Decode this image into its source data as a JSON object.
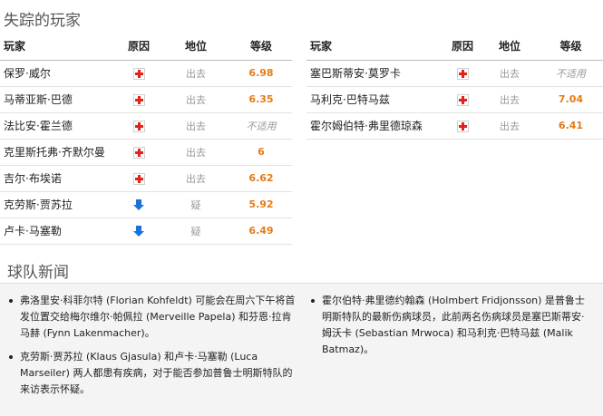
{
  "missing_players": {
    "title": "失踪的玩家",
    "headers": {
      "player": "玩家",
      "reason": "原因",
      "status": "地位",
      "rating": "等级"
    },
    "left_rows": [
      {
        "player": "保罗·威尔",
        "reason_icon": "injury-icon",
        "status": "出去",
        "rating": "6.98",
        "rating_na": false
      },
      {
        "player": "马蒂亚斯·巴德",
        "reason_icon": "injury-icon",
        "status": "出去",
        "rating": "6.35",
        "rating_na": false
      },
      {
        "player": "法比安·霍兰德",
        "reason_icon": "injury-icon",
        "status": "出去",
        "rating": "不适用",
        "rating_na": true
      },
      {
        "player": "克里斯托弗·齐默尔曼",
        "reason_icon": "injury-icon",
        "status": "出去",
        "rating": "6",
        "rating_na": false
      },
      {
        "player": "吉尔·布埃诺",
        "reason_icon": "injury-icon",
        "status": "出去",
        "rating": "6.62",
        "rating_na": false
      },
      {
        "player": "克劳斯·贾苏拉",
        "reason_icon": "doubt-arrow-icon",
        "status": "疑",
        "rating": "5.92",
        "rating_na": false
      },
      {
        "player": "卢卡·马塞勒",
        "reason_icon": "doubt-arrow-icon",
        "status": "疑",
        "rating": "6.49",
        "rating_na": false
      }
    ],
    "right_rows": [
      {
        "player": "塞巴斯蒂安·莫罗卡",
        "reason_icon": "injury-icon",
        "status": "出去",
        "rating": "不适用",
        "rating_na": true
      },
      {
        "player": "马利克·巴特马兹",
        "reason_icon": "injury-icon",
        "status": "出去",
        "rating": "7.04",
        "rating_na": false
      },
      {
        "player": "霍尔姆伯特·弗里德琼森",
        "reason_icon": "injury-icon",
        "status": "出去",
        "rating": "6.41",
        "rating_na": false
      }
    ]
  },
  "team_news": {
    "title": "球队新闻",
    "left_items": [
      "弗洛里安·科菲尔特 (Florian Kohfeldt) 可能会在周六下午将首发位置交给梅尔维尔·帕佩拉 (Merveille Papela) 和芬恩·拉肯马赫 (Fynn Lakenmacher)。",
      "克劳斯·贾苏拉 (Klaus Gjasula) 和卢卡·马塞勒 (Luca Marseiler) 两人都患有疾病，对于能否参加普鲁士明斯特队的来访表示怀疑。"
    ],
    "right_items": [
      "霍尔伯特·弗里德约翰森 (Holmbert Fridjonsson) 是普鲁士明斯特队的最新伤病球员，此前两名伤病球员是塞巴斯蒂安·姆沃卡 (Sebastian Mrwoca) 和马利克·巴特马兹 (Malik Batmaz)。"
    ]
  },
  "colors": {
    "rating": "#e57b16",
    "injury": "#e2231a",
    "doubt_arrow": "#1a73d9",
    "muted": "#999999"
  }
}
